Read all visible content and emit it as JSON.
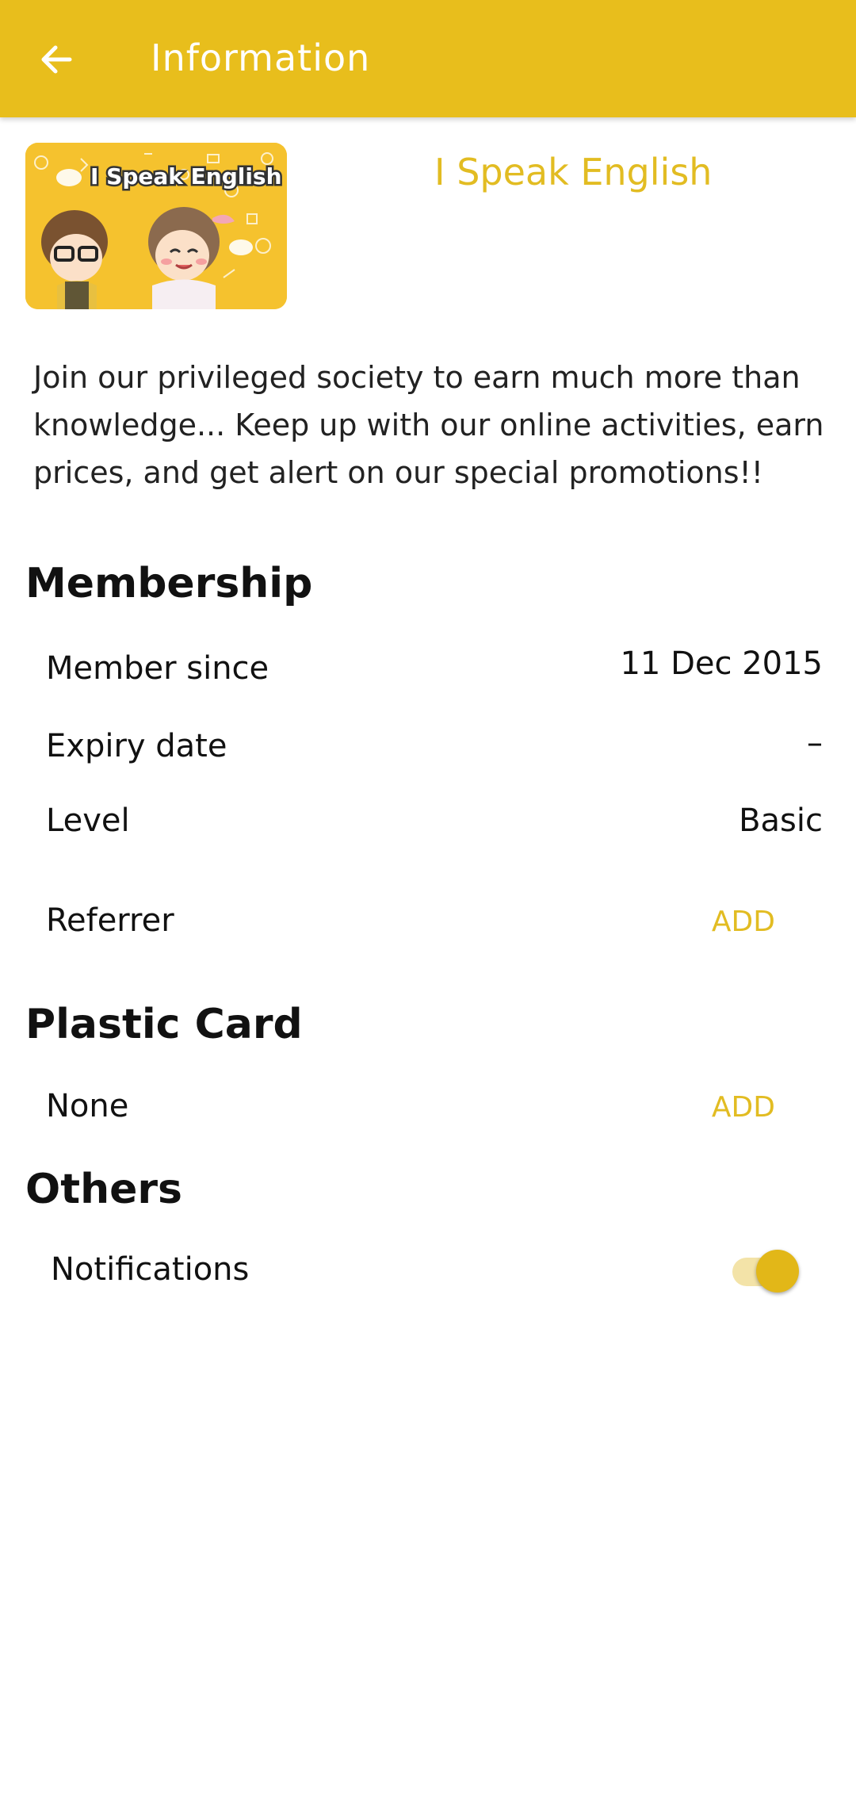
{
  "appbar": {
    "title": "Information",
    "back_icon": "arrow-left-icon"
  },
  "card": {
    "image_text": "I Speak English",
    "title": "I Speak English"
  },
  "description": "Join our privileged society to earn much more than knowledge... Keep up with our online activities, earn prices, and get alert on our special promotions!!",
  "membership": {
    "heading": "Membership",
    "member_since_label": "Member since",
    "member_since_value": "11 Dec 2015",
    "expiry_label": "Expiry date",
    "expiry_value": "–",
    "level_label": "Level",
    "level_value": "Basic",
    "referrer_label": "Referrer",
    "referrer_action": "ADD"
  },
  "plastic_card": {
    "heading": "Plastic Card",
    "value": "None",
    "action": "ADD"
  },
  "others": {
    "heading": "Others",
    "notifications_label": "Notifications",
    "notifications_on": true
  },
  "colors": {
    "accent": "#E8BE1C",
    "link": "#E2BC22"
  }
}
